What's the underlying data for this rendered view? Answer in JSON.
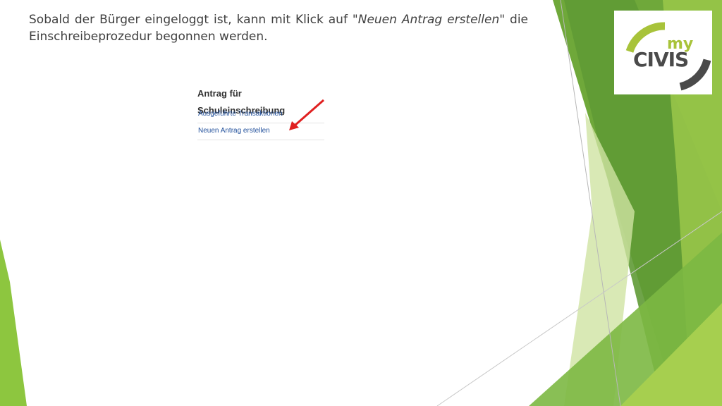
{
  "slide": {
    "instruction": {
      "part1": "Sobald der Bürger eingeloggt ist, kann mit Klick auf \"",
      "emphasis": "Neuen Antrag erstellen",
      "part2": "\" die Einschreibeprozedur begonnen werden."
    }
  },
  "logo": {
    "my": "my",
    "civis": "CIVIS"
  },
  "panel": {
    "title": "Antrag für Schuleinschreibung",
    "links": [
      {
        "label": "Ausgeführte Transaktionen"
      },
      {
        "label": "Neuen Antrag erstellen"
      }
    ]
  },
  "colors": {
    "arrow": "#e02020",
    "link": "#1f4e9a",
    "accent_green": "#8dc63f",
    "dark_green": "#5e9c32"
  }
}
